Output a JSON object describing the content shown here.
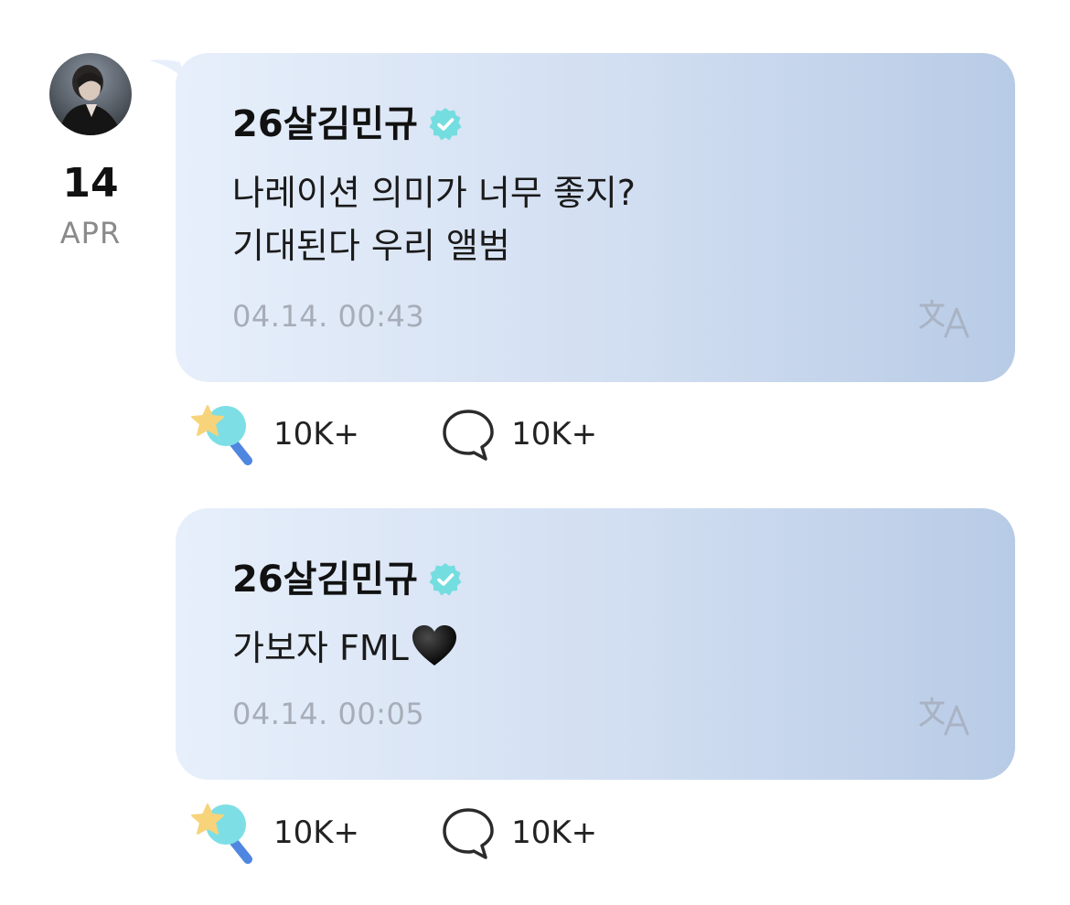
{
  "date": {
    "day": "14",
    "month": "APR"
  },
  "posts": [
    {
      "author": "26살김민규",
      "lines": [
        "나레이션 의미가 너무 좋지?",
        "기대된다 우리 앨범"
      ],
      "timestamp": "04.14. 00:43",
      "reactions": "10K+",
      "comments": "10K+"
    },
    {
      "author": "26살김민규",
      "lines": [
        "가보자 FML"
      ],
      "emoji": "black-heart",
      "timestamp": "04.14. 00:05",
      "reactions": "10K+",
      "comments": "10K+"
    }
  ],
  "icons": {
    "verified": "verified-badge-icon",
    "translate": "translate-icon",
    "reaction": "star-lollipop-icon",
    "comment": "speech-bubble-icon"
  },
  "colors": {
    "verified": "#74dde0",
    "bubble_start": "#e7effb",
    "bubble_end": "#b8cbe6",
    "timestamp": "#a7adb8",
    "date_month": "#8a8a8a"
  }
}
